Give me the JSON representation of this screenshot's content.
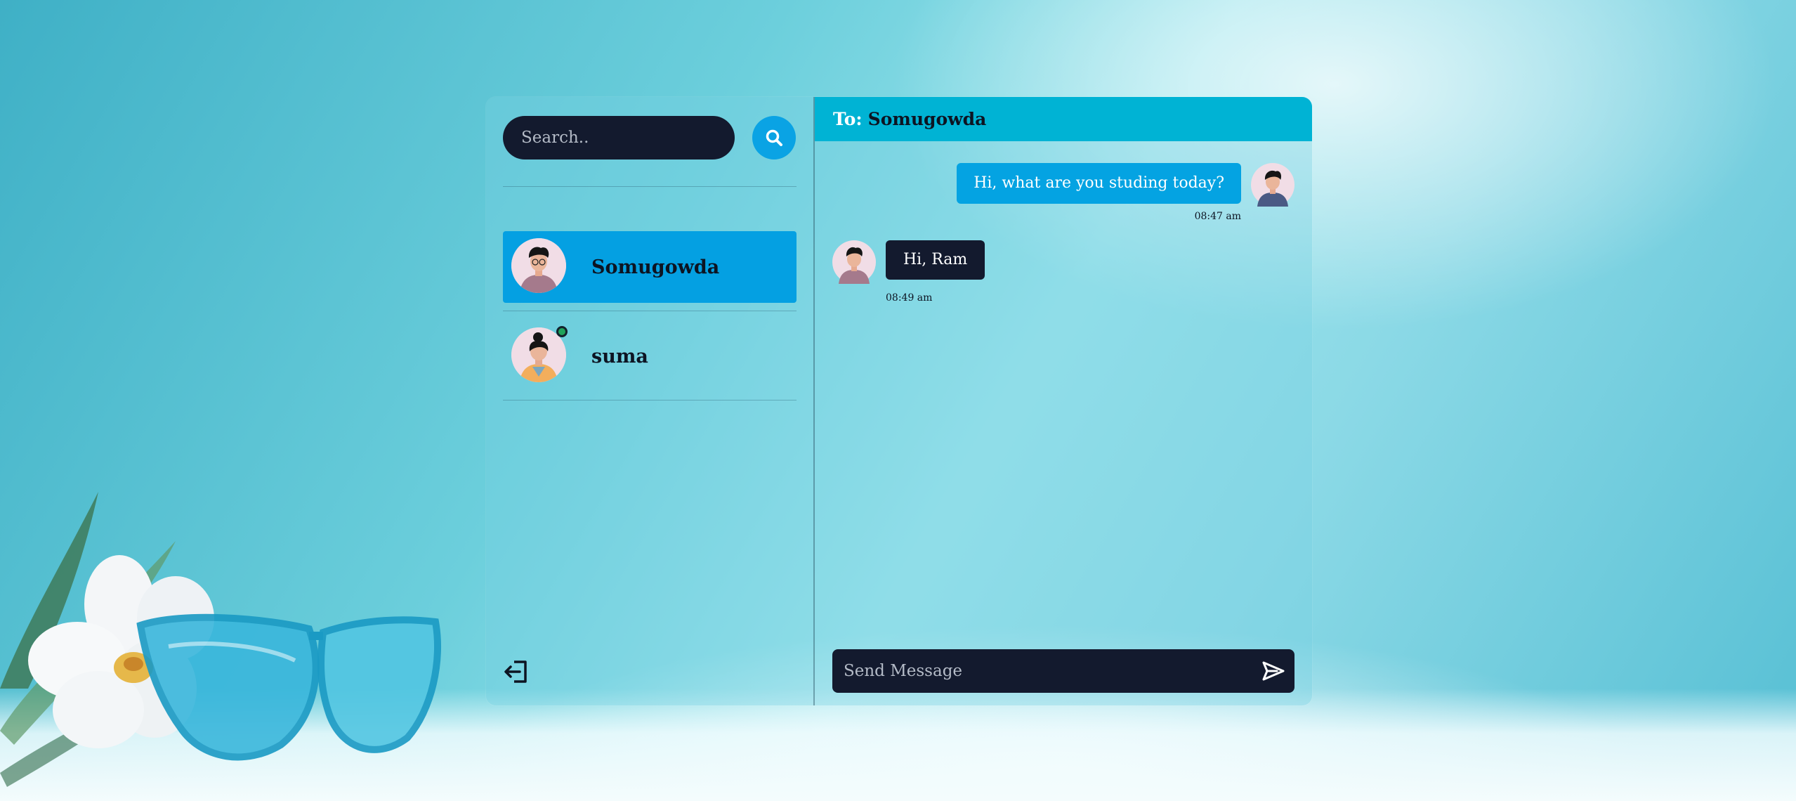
{
  "search": {
    "placeholder": "Search.."
  },
  "contacts": [
    {
      "name": "Somugowda",
      "active": true,
      "online": false
    },
    {
      "name": "suma",
      "active": false,
      "online": true
    }
  ],
  "chat": {
    "to_label": "To:",
    "to_name": "Somugowda",
    "messages": [
      {
        "direction": "outgoing",
        "text": "Hi, what are you studing today?",
        "time": "08:47 am"
      },
      {
        "direction": "incoming",
        "text": "Hi, Ram",
        "time": "08:49 am"
      }
    ],
    "composer_placeholder": "Send Message"
  },
  "icons": {
    "search": "search-icon",
    "send": "send-icon",
    "logout": "logout-icon"
  },
  "colors": {
    "accent": "#04a0e2",
    "header": "#00b3d4",
    "dark": "#131a2e",
    "online": "#1fa35b"
  }
}
